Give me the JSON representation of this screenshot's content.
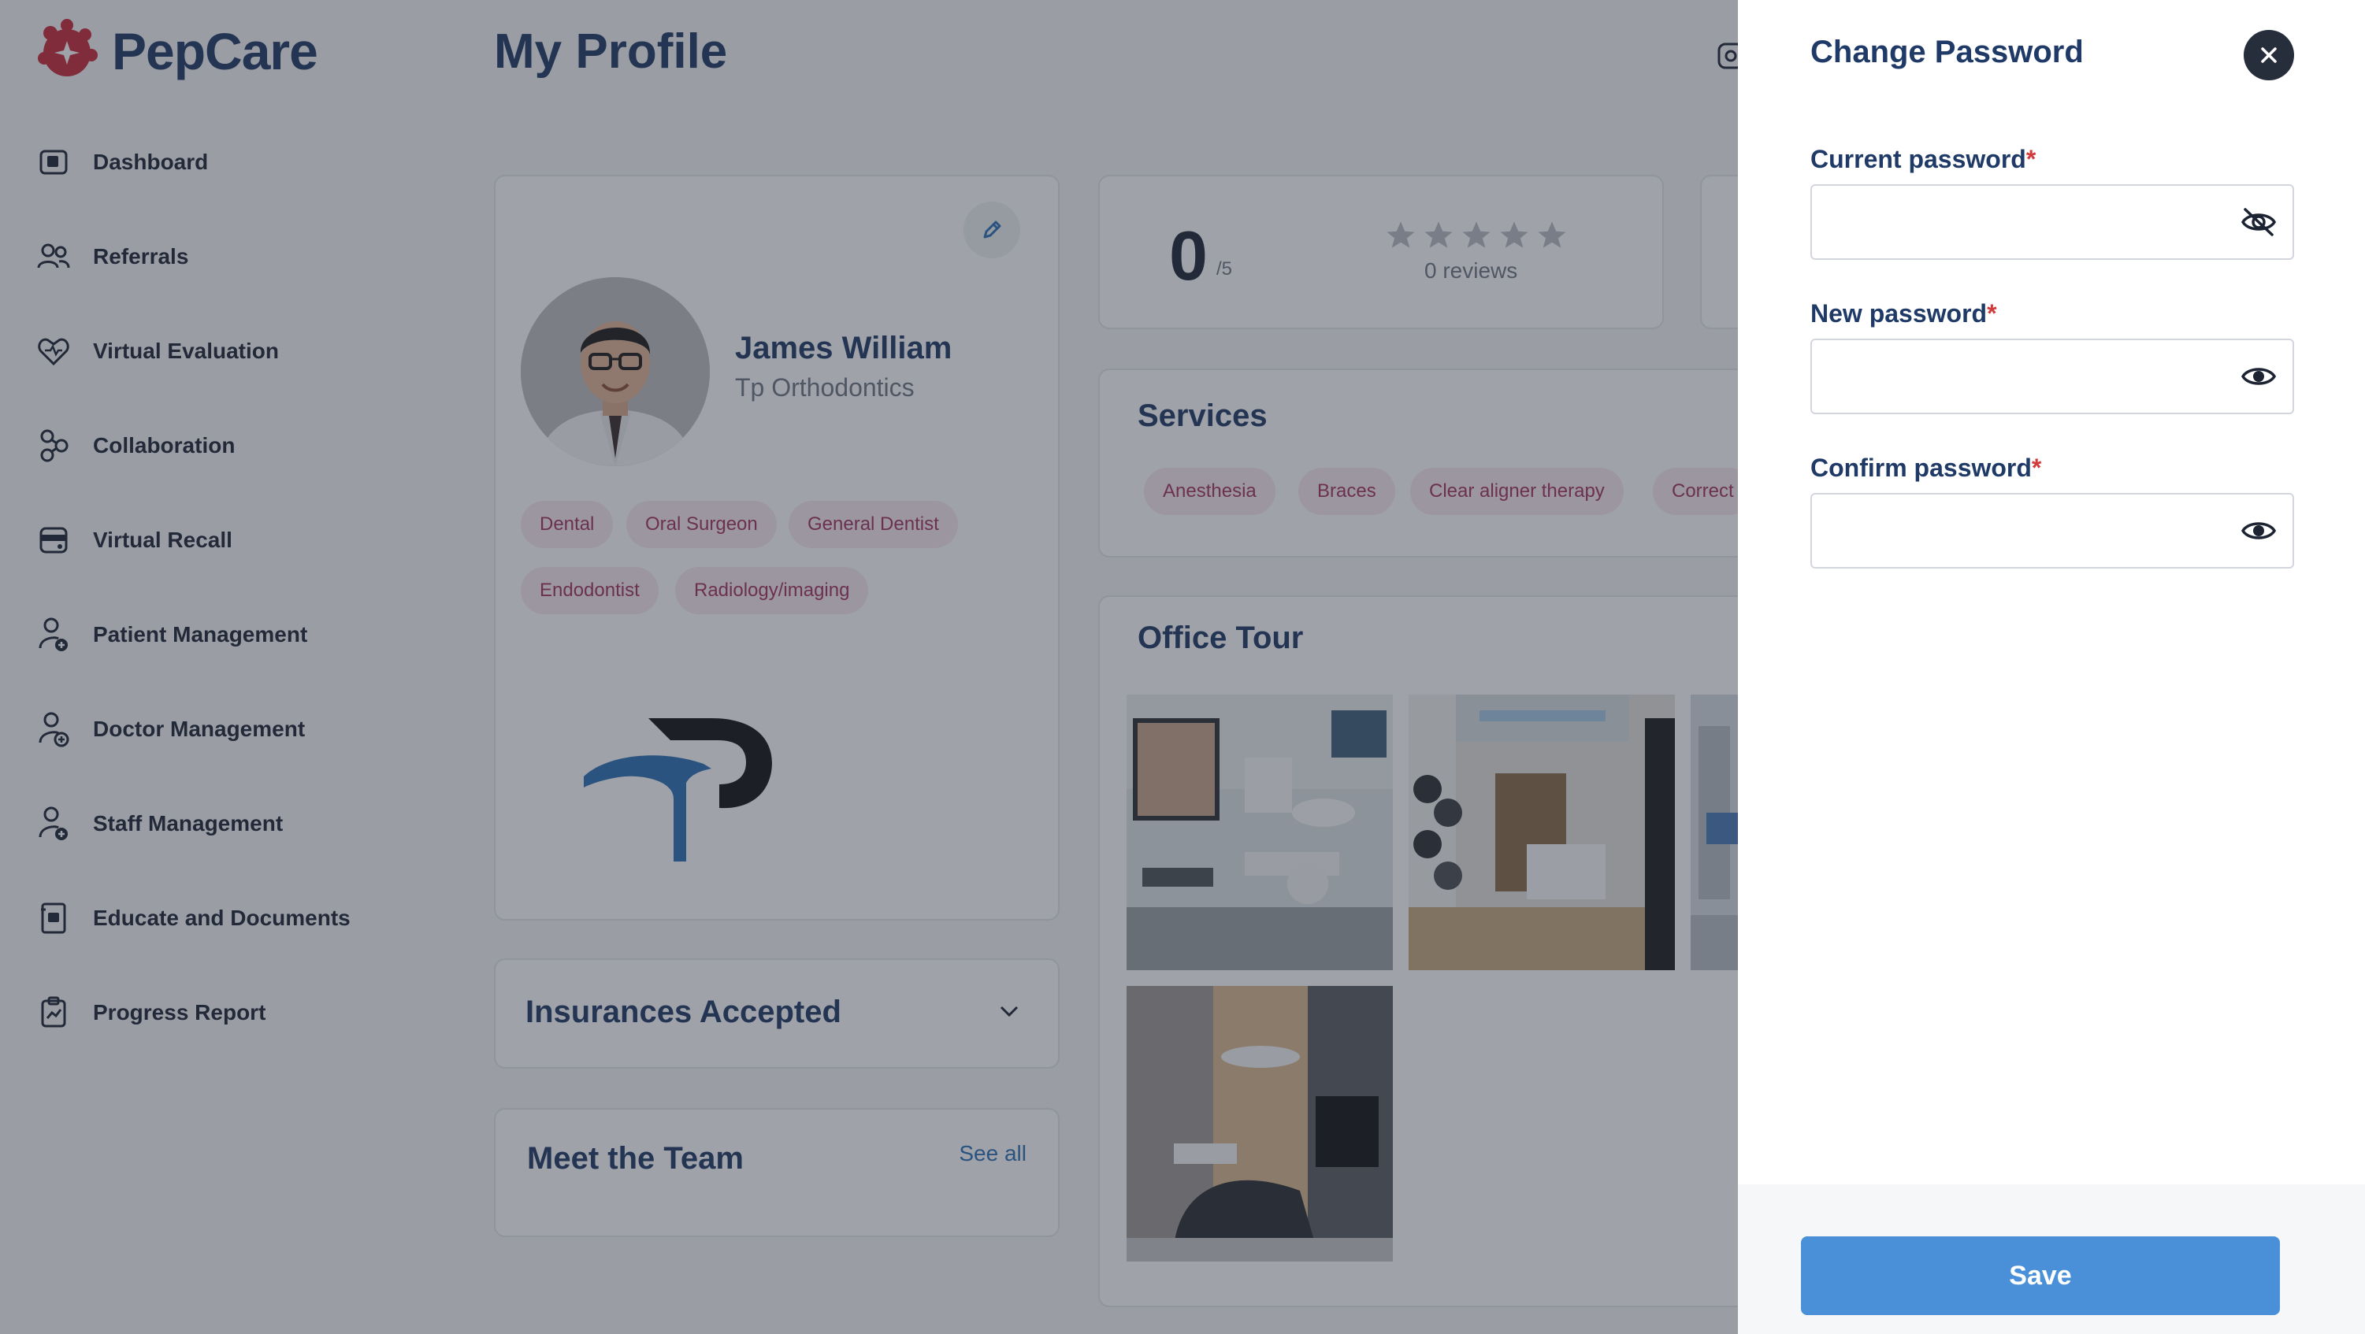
{
  "app": {
    "brand": "PepCare"
  },
  "sidebar": {
    "items": [
      {
        "label": "Dashboard"
      },
      {
        "label": "Referrals"
      },
      {
        "label": "Virtual Evaluation"
      },
      {
        "label": "Collaboration"
      },
      {
        "label": "Virtual Recall"
      },
      {
        "label": "Patient Management"
      },
      {
        "label": "Doctor Management"
      },
      {
        "label": "Staff Management"
      },
      {
        "label": "Educate and Documents"
      },
      {
        "label": "Progress Report"
      }
    ]
  },
  "page": {
    "title": "My Profile"
  },
  "profile": {
    "name": "James William",
    "practice": "Tp Orthodontics",
    "specialties": [
      "Dental",
      "Oral Surgeon",
      "General Dentist",
      "Endodontist",
      "Radiology/imaging"
    ]
  },
  "rating": {
    "score": "0",
    "out_of": "/5",
    "reviews_text": "0 reviews",
    "stars_filled": 0,
    "stars_total": 5
  },
  "services": {
    "title": "Services",
    "items": [
      "Anesthesia",
      "Braces",
      "Clear aligner therapy",
      "Correct"
    ]
  },
  "office_tour": {
    "title": "Office Tour"
  },
  "insurances": {
    "title": "Insurances Accepted"
  },
  "team": {
    "title": "Meet the Team",
    "see_all": "See all"
  },
  "drawer": {
    "title": "Change Password",
    "fields": [
      {
        "label": "Current password",
        "required_mark": "*",
        "value": "",
        "visibility_icon": "eye-off-icon"
      },
      {
        "label": "New password",
        "required_mark": "*",
        "value": "",
        "visibility_icon": "eye-icon"
      },
      {
        "label": "Confirm password",
        "required_mark": "*",
        "value": "",
        "visibility_icon": "eye-icon"
      }
    ],
    "save_label": "Save"
  },
  "colors": {
    "brand_navy": "#1f3a67",
    "brand_red": "#c8293a",
    "chip_bg": "#f8e9f0",
    "chip_text": "#a33261",
    "save_button": "#4a90d9",
    "required": "#d33a3a"
  }
}
